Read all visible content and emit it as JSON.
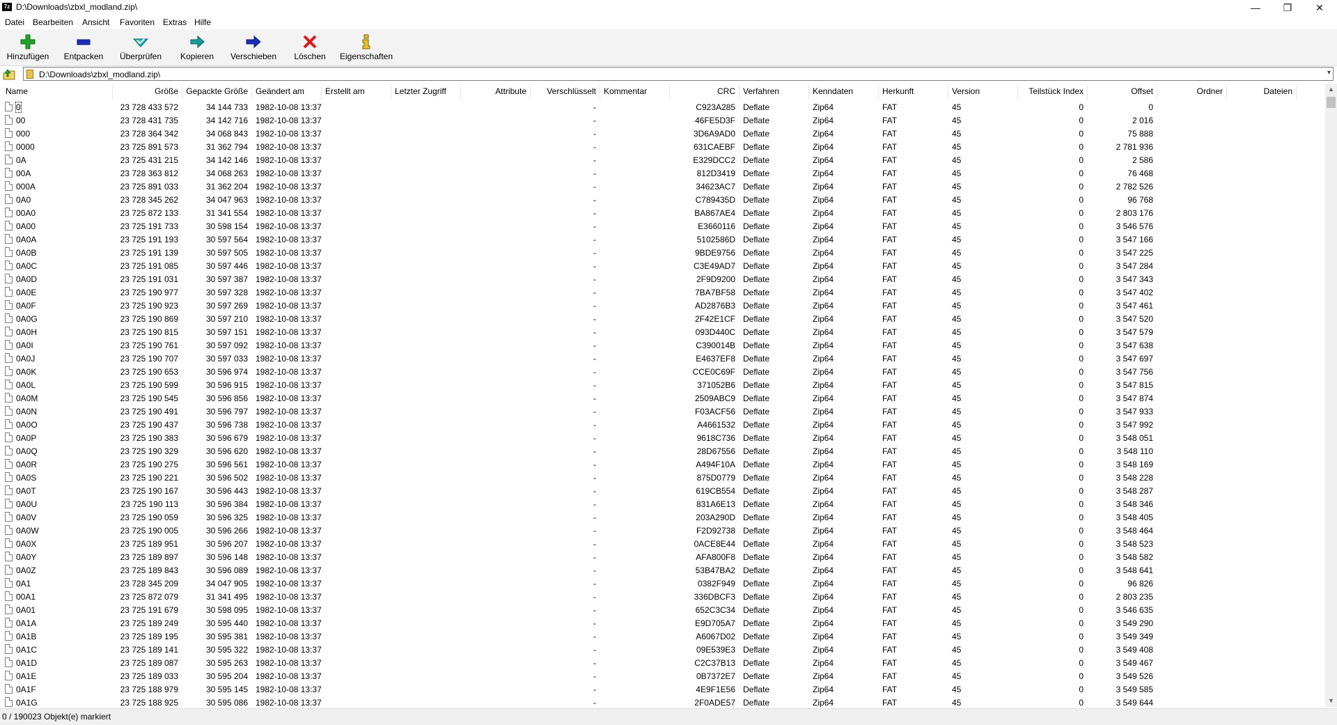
{
  "window": {
    "app_icon": "7z",
    "title": "D:\\Downloads\\zbxl_modland.zip\\",
    "minimize": "—",
    "restore": "❐",
    "close": "✕"
  },
  "menu": [
    "Datei",
    "Bearbeiten",
    "Ansicht",
    "Favoriten",
    "Extras",
    "Hilfe"
  ],
  "toolbar": [
    {
      "id": "add",
      "label": "Hinzufügen",
      "icon": "plus-icon",
      "color": "#22a52a"
    },
    {
      "id": "extract",
      "label": "Entpacken",
      "icon": "minus-icon",
      "color": "#1b2fb8"
    },
    {
      "id": "test",
      "label": "Überprüfen",
      "icon": "check-icon",
      "color": "#1fb5b5"
    },
    {
      "id": "copy",
      "label": "Kopieren",
      "icon": "copy-arrow-icon",
      "color": "#1a9a9a"
    },
    {
      "id": "move",
      "label": "Verschieben",
      "icon": "move-arrow-icon",
      "color": "#1b2fb8"
    },
    {
      "id": "delete",
      "label": "Löschen",
      "icon": "delete-x-icon",
      "color": "#e01818"
    },
    {
      "id": "info",
      "label": "Eigenschaften",
      "icon": "info-icon",
      "color": "#e2c22a"
    }
  ],
  "address": {
    "path": "D:\\Downloads\\zbxl_modland.zip\\"
  },
  "columns": [
    "Name",
    "Größe",
    "Gepackte Größe",
    "Geändert am",
    "Erstellt am",
    "Letzter Zugriff",
    "Attribute",
    "Verschlüsselt",
    "Kommentar",
    "CRC",
    "Verfahren",
    "Kenndaten",
    "Herkunft",
    "Version",
    "Teilstück Index",
    "Offset",
    "Ordner",
    "Dateien"
  ],
  "rows": [
    [
      "0",
      "23 728 433 572",
      "34 144 733",
      "1982-10-08 13:37",
      "-",
      "C923A285",
      "0"
    ],
    [
      "00",
      "23 728 431 735",
      "34 142 716",
      "1982-10-08 13:37",
      "-",
      "46FE5D3F",
      "2 016"
    ],
    [
      "000",
      "23 728 364 342",
      "34 068 843",
      "1982-10-08 13:37",
      "-",
      "3D6A9AD0",
      "75 888"
    ],
    [
      "0000",
      "23 725 891 573",
      "31 362 794",
      "1982-10-08 13:37",
      "-",
      "631CAEBF",
      "2 781 936"
    ],
    [
      "0A",
      "23 725 431 215",
      "34 142 146",
      "1982-10-08 13:37",
      "-",
      "E329DCC2",
      "2 586"
    ],
    [
      "00A",
      "23 728 363 812",
      "34 068 263",
      "1982-10-08 13:37",
      "-",
      "812D3419",
      "76 468"
    ],
    [
      "000A",
      "23 725 891 033",
      "31 362 204",
      "1982-10-08 13:37",
      "-",
      "34623AC7",
      "2 782 526"
    ],
    [
      "0A0",
      "23 728 345 262",
      "34 047 963",
      "1982-10-08 13:37",
      "-",
      "C789435D",
      "96 768"
    ],
    [
      "00A0",
      "23 725 872 133",
      "31 341 554",
      "1982-10-08 13:37",
      "-",
      "BA867AE4",
      "2 803 176"
    ],
    [
      "0A00",
      "23 725 191 733",
      "30 598 154",
      "1982-10-08 13:37",
      "-",
      "E3660116",
      "3 546 576"
    ],
    [
      "0A0A",
      "23 725 191 193",
      "30 597 564",
      "1982-10-08 13:37",
      "-",
      "5102586D",
      "3 547 166"
    ],
    [
      "0A0B",
      "23 725 191 139",
      "30 597 505",
      "1982-10-08 13:37",
      "-",
      "9BDE9756",
      "3 547 225"
    ],
    [
      "0A0C",
      "23 725 191 085",
      "30 597 446",
      "1982-10-08 13:37",
      "-",
      "C3E49AD7",
      "3 547 284"
    ],
    [
      "0A0D",
      "23 725 191 031",
      "30 597 387",
      "1982-10-08 13:37",
      "-",
      "2F9D9200",
      "3 547 343"
    ],
    [
      "0A0E",
      "23 725 190 977",
      "30 597 328",
      "1982-10-08 13:37",
      "-",
      "7BA7BF58",
      "3 547 402"
    ],
    [
      "0A0F",
      "23 725 190 923",
      "30 597 269",
      "1982-10-08 13:37",
      "-",
      "AD2876B3",
      "3 547 461"
    ],
    [
      "0A0G",
      "23 725 190 869",
      "30 597 210",
      "1982-10-08 13:37",
      "-",
      "2F42E1CF",
      "3 547 520"
    ],
    [
      "0A0H",
      "23 725 190 815",
      "30 597 151",
      "1982-10-08 13:37",
      "-",
      "093D440C",
      "3 547 579"
    ],
    [
      "0A0I",
      "23 725 190 761",
      "30 597 092",
      "1982-10-08 13:37",
      "-",
      "C390014B",
      "3 547 638"
    ],
    [
      "0A0J",
      "23 725 190 707",
      "30 597 033",
      "1982-10-08 13:37",
      "-",
      "E4637EF8",
      "3 547 697"
    ],
    [
      "0A0K",
      "23 725 190 653",
      "30 596 974",
      "1982-10-08 13:37",
      "-",
      "CCE0C69F",
      "3 547 756"
    ],
    [
      "0A0L",
      "23 725 190 599",
      "30 596 915",
      "1982-10-08 13:37",
      "-",
      "371052B6",
      "3 547 815"
    ],
    [
      "0A0M",
      "23 725 190 545",
      "30 596 856",
      "1982-10-08 13:37",
      "-",
      "2509ABC9",
      "3 547 874"
    ],
    [
      "0A0N",
      "23 725 190 491",
      "30 596 797",
      "1982-10-08 13:37",
      "-",
      "F03ACF56",
      "3 547 933"
    ],
    [
      "0A0O",
      "23 725 190 437",
      "30 596 738",
      "1982-10-08 13:37",
      "-",
      "A4661532",
      "3 547 992"
    ],
    [
      "0A0P",
      "23 725 190 383",
      "30 596 679",
      "1982-10-08 13:37",
      "-",
      "9618C736",
      "3 548 051"
    ],
    [
      "0A0Q",
      "23 725 190 329",
      "30 596 620",
      "1982-10-08 13:37",
      "-",
      "28D67556",
      "3 548 110"
    ],
    [
      "0A0R",
      "23 725 190 275",
      "30 596 561",
      "1982-10-08 13:37",
      "-",
      "A494F10A",
      "3 548 169"
    ],
    [
      "0A0S",
      "23 725 190 221",
      "30 596 502",
      "1982-10-08 13:37",
      "-",
      "875D0779",
      "3 548 228"
    ],
    [
      "0A0T",
      "23 725 190 167",
      "30 596 443",
      "1982-10-08 13:37",
      "-",
      "619CB554",
      "3 548 287"
    ],
    [
      "0A0U",
      "23 725 190 113",
      "30 596 384",
      "1982-10-08 13:37",
      "-",
      "831A6E13",
      "3 548 346"
    ],
    [
      "0A0V",
      "23 725 190 059",
      "30 596 325",
      "1982-10-08 13:37",
      "-",
      "203A290D",
      "3 548 405"
    ],
    [
      "0A0W",
      "23 725 190 005",
      "30 596 266",
      "1982-10-08 13:37",
      "-",
      "F2D92738",
      "3 548 464"
    ],
    [
      "0A0X",
      "23 725 189 951",
      "30 596 207",
      "1982-10-08 13:37",
      "-",
      "0ACE8E44",
      "3 548 523"
    ],
    [
      "0A0Y",
      "23 725 189 897",
      "30 596 148",
      "1982-10-08 13:37",
      "-",
      "AFA800F8",
      "3 548 582"
    ],
    [
      "0A0Z",
      "23 725 189 843",
      "30 596 089",
      "1982-10-08 13:37",
      "-",
      "53B47BA2",
      "3 548 641"
    ],
    [
      "0A1",
      "23 728 345 209",
      "34 047 905",
      "1982-10-08 13:37",
      "-",
      "0382F949",
      "96 826"
    ],
    [
      "00A1",
      "23 725 872 079",
      "31 341 495",
      "1982-10-08 13:37",
      "-",
      "336DBCF3",
      "2 803 235"
    ],
    [
      "0A01",
      "23 725 191 679",
      "30 598 095",
      "1982-10-08 13:37",
      "-",
      "652C3C34",
      "3 546 635"
    ],
    [
      "0A1A",
      "23 725 189 249",
      "30 595 440",
      "1982-10-08 13:37",
      "-",
      "E9D705A7",
      "3 549 290"
    ],
    [
      "0A1B",
      "23 725 189 195",
      "30 595 381",
      "1982-10-08 13:37",
      "-",
      "A6067D02",
      "3 549 349"
    ],
    [
      "0A1C",
      "23 725 189 141",
      "30 595 322",
      "1982-10-08 13:37",
      "-",
      "09E539E3",
      "3 549 408"
    ],
    [
      "0A1D",
      "23 725 189 087",
      "30 595 263",
      "1982-10-08 13:37",
      "-",
      "C2C37B13",
      "3 549 467"
    ],
    [
      "0A1E",
      "23 725 189 033",
      "30 595 204",
      "1982-10-08 13:37",
      "-",
      "0B7372E7",
      "3 549 526"
    ],
    [
      "0A1F",
      "23 725 188 979",
      "30 595 145",
      "1982-10-08 13:37",
      "-",
      "4E9F1E56",
      "3 549 585"
    ],
    [
      "0A1G",
      "23 725 188 925",
      "30 595 086",
      "1982-10-08 13:37",
      "-",
      "2F0ADE57",
      "3 549 644"
    ]
  ],
  "row_common": {
    "method": "Deflate",
    "characteristics": "Zip64",
    "host_os": "FAT",
    "version": "45",
    "volume_index": "0"
  },
  "status": "0 / 190023 Objekt(e) markiert"
}
